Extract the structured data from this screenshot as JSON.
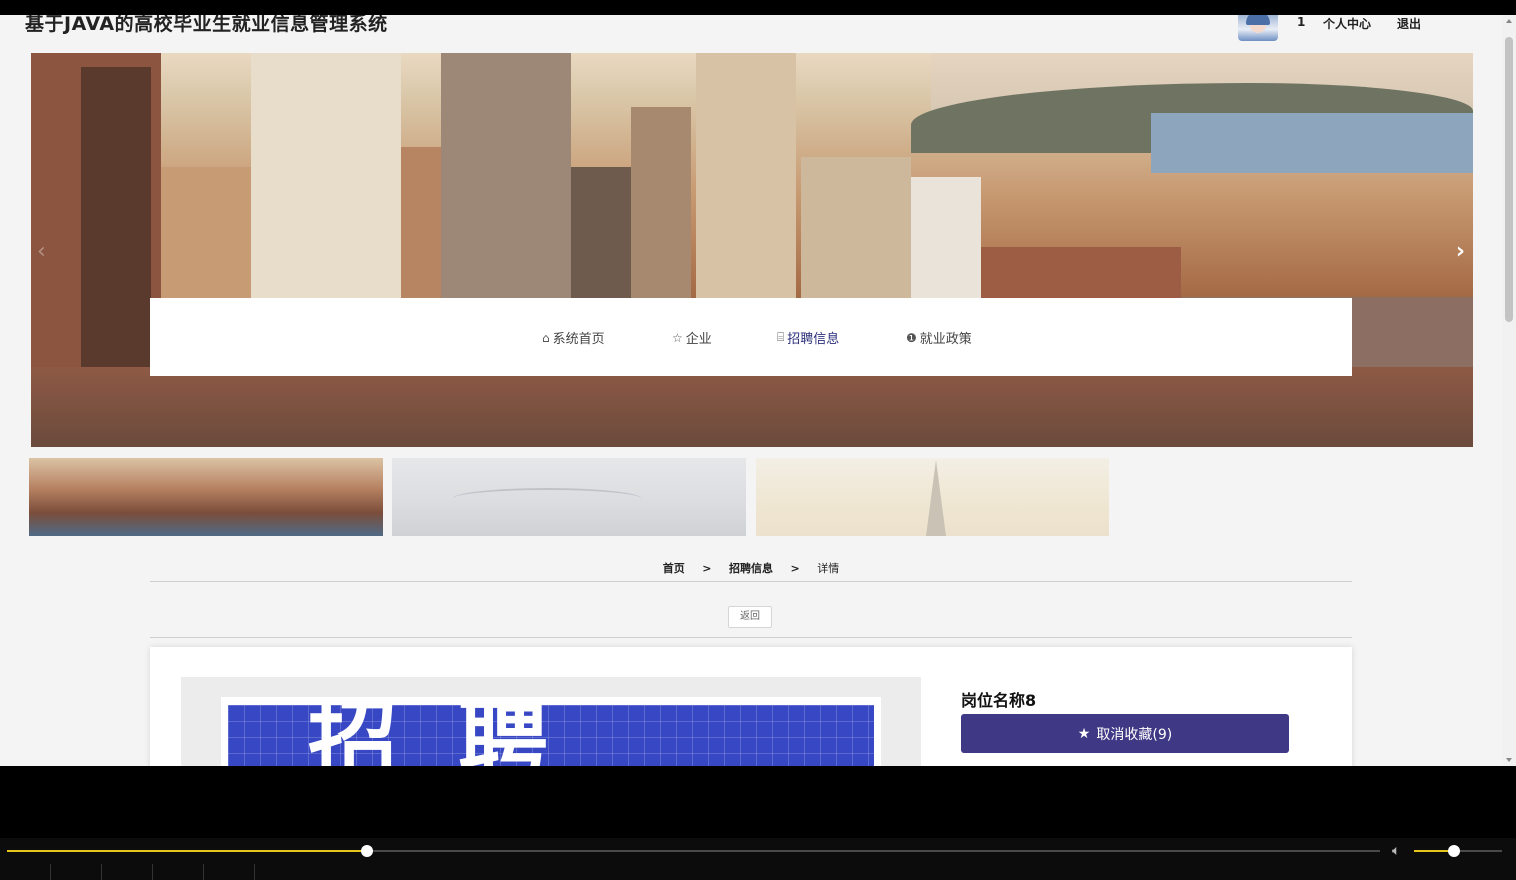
{
  "header": {
    "title": "基于JAVA的高校毕业生就业信息管理系统",
    "user_id": "1",
    "user_center": "个人中心",
    "logout": "退出"
  },
  "nav": {
    "items": [
      {
        "label": "系统首页",
        "icon": "home-icon"
      },
      {
        "label": "企业",
        "icon": "star-icon"
      },
      {
        "label": "招聘信息",
        "icon": "bag-icon",
        "active": true
      },
      {
        "label": "就业政策",
        "icon": "info-icon"
      }
    ]
  },
  "breadcrumb": {
    "home": "首页",
    "sep": ">",
    "section": "招聘信息",
    "current": "详情"
  },
  "back_label": "返回",
  "detail": {
    "job_title": "岗位名称8",
    "favorite_label": "取消收藏(9)",
    "poster_text": "招聘"
  },
  "player": {
    "progress": 0.262,
    "volume": 0.45,
    "accent_color": "#e8c51d"
  },
  "colors": {
    "nav_active": "#2b2f7b",
    "favorite_button": "#3f3884"
  }
}
